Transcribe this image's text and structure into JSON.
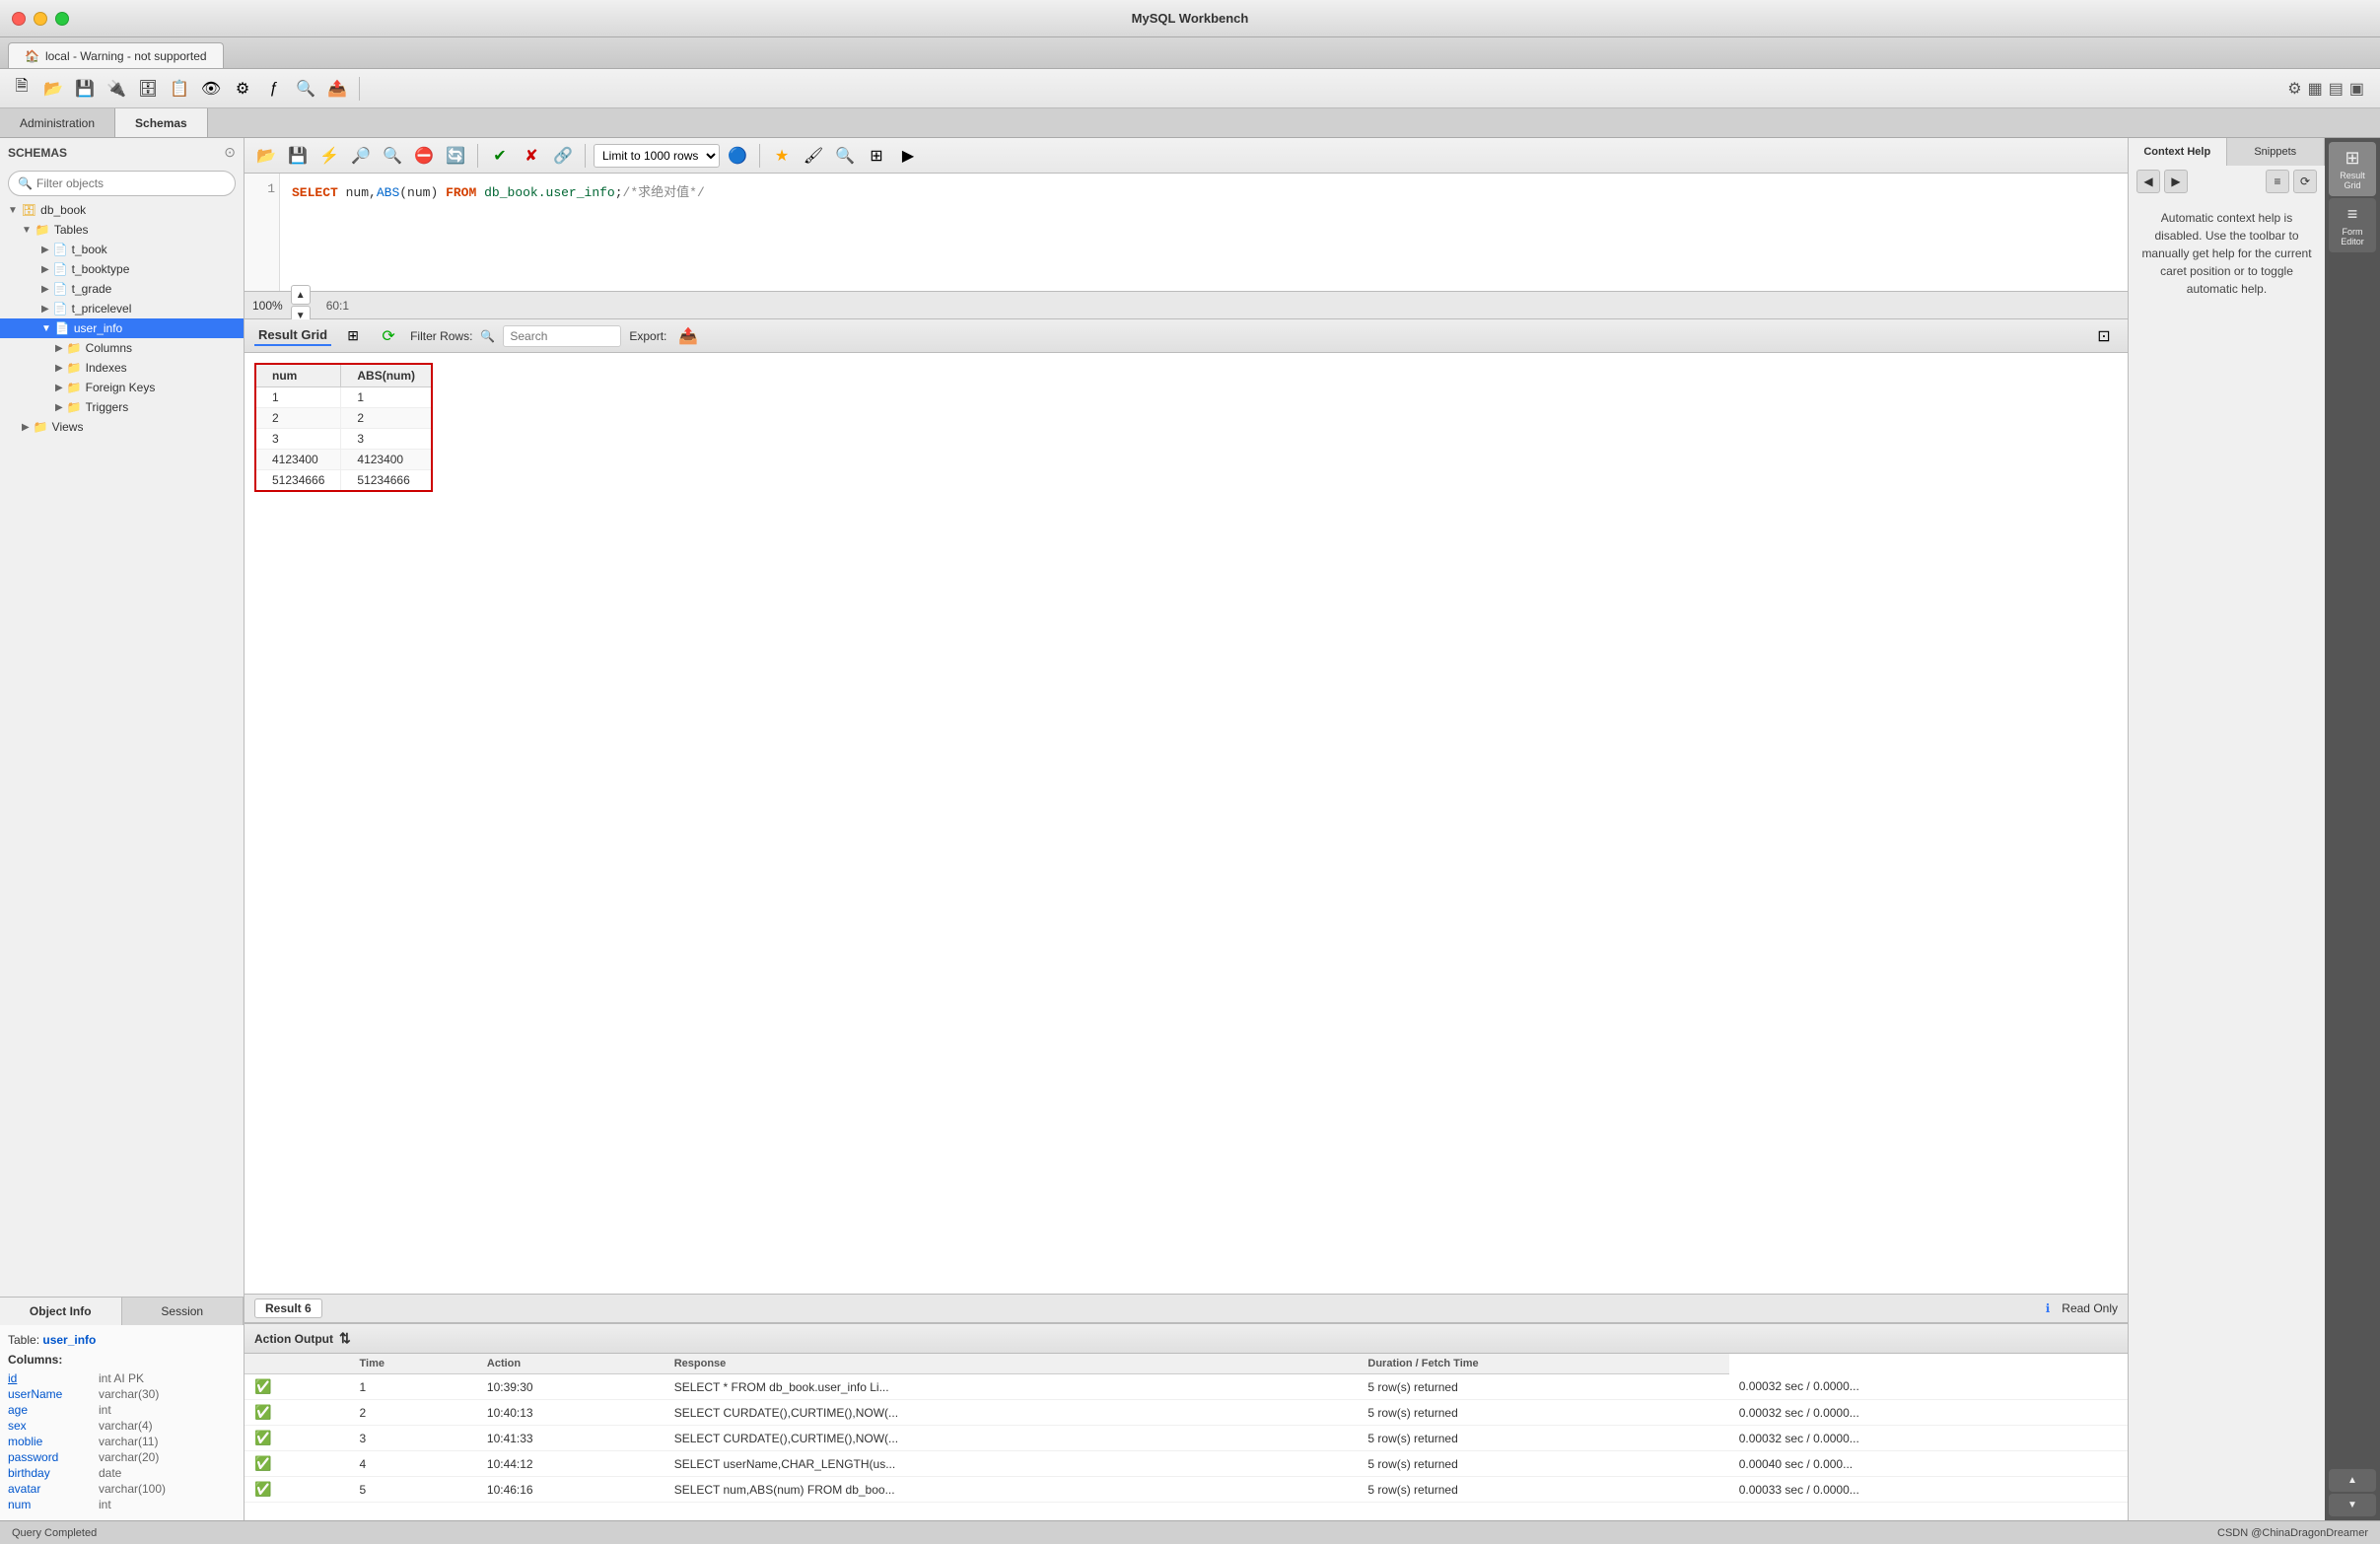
{
  "titlebar": {
    "title": "MySQL Workbench"
  },
  "tab": {
    "label": "local - Warning - not supported",
    "icon": "🏠"
  },
  "panel_tabs": [
    "Administration",
    "Schemas"
  ],
  "schemas_header": "SCHEMAS",
  "filter_placeholder": "Filter objects",
  "tree": [
    {
      "label": "db_book",
      "level": 1,
      "type": "db",
      "expanded": true
    },
    {
      "label": "Tables",
      "level": 2,
      "type": "folder",
      "expanded": true
    },
    {
      "label": "t_book",
      "level": 3,
      "type": "table"
    },
    {
      "label": "t_booktype",
      "level": 3,
      "type": "table"
    },
    {
      "label": "t_grade",
      "level": 3,
      "type": "table"
    },
    {
      "label": "t_pricelevel",
      "level": 3,
      "type": "table"
    },
    {
      "label": "user_info",
      "level": 3,
      "type": "table",
      "selected": true
    },
    {
      "label": "Columns",
      "level": 4,
      "type": "folder"
    },
    {
      "label": "Indexes",
      "level": 4,
      "type": "folder"
    },
    {
      "label": "Foreign Keys",
      "level": 4,
      "type": "folder"
    },
    {
      "label": "Triggers",
      "level": 4,
      "type": "folder"
    },
    {
      "label": "Views",
      "level": 2,
      "type": "folder"
    }
  ],
  "object_info_tabs": [
    "Object Info",
    "Session"
  ],
  "object_info": {
    "table_label": "Table:",
    "table_name": "user_info",
    "columns_label": "Columns:",
    "columns": [
      {
        "name": "id",
        "type": "int AI PK",
        "is_pk": true
      },
      {
        "name": "userName",
        "type": "varchar(30)"
      },
      {
        "name": "age",
        "type": "int"
      },
      {
        "name": "sex",
        "type": "varchar(4)"
      },
      {
        "name": "moblie",
        "type": "varchar(11)"
      },
      {
        "name": "password",
        "type": "varchar(20)"
      },
      {
        "name": "birthday",
        "type": "date"
      },
      {
        "name": "avatar",
        "type": "varchar(100)"
      },
      {
        "name": "num",
        "type": "int"
      }
    ]
  },
  "context_tabs": [
    "Context Help",
    "Snippets"
  ],
  "context_help_text": "Automatic context help is disabled. Use the toolbar to manually get help for the current caret position or to toggle automatic help.",
  "sql_line": "1",
  "sql_code": "SELECT num,ABS(num) FROM db_book.user_info;/*求绝对值*/",
  "zoom": "100%",
  "caret_pos": "60:1",
  "limit_label": "Limit to 1000 rows",
  "result_toolbar": {
    "result_grid_label": "Result Grid",
    "filter_rows_label": "Filter Rows:",
    "search_placeholder": "Search",
    "export_label": "Export:"
  },
  "result_grid": {
    "columns": [
      "num",
      "ABS(num)"
    ],
    "rows": [
      [
        "1",
        "1"
      ],
      [
        "2",
        "2"
      ],
      [
        "3",
        "3"
      ],
      [
        "4123400",
        "4123400"
      ],
      [
        "51234666",
        "51234666"
      ]
    ]
  },
  "result_tab": "Result 6",
  "read_only_label": "Read Only",
  "action_output_header": "Action Output",
  "action_table": {
    "columns": [
      "",
      "Time",
      "Action",
      "Response",
      "Duration / Fetch Time"
    ],
    "rows": [
      {
        "num": "1",
        "time": "10:39:30",
        "action": "SELECT * FROM db_book.user_info Li...",
        "response": "5 row(s) returned",
        "duration": "0.00032 sec / 0.0000..."
      },
      {
        "num": "2",
        "time": "10:40:13",
        "action": "SELECT CURDATE(),CURTIME(),NOW(...",
        "response": "5 row(s) returned",
        "duration": "0.00032 sec / 0.0000..."
      },
      {
        "num": "3",
        "time": "10:41:33",
        "action": "SELECT CURDATE(),CURTIME(),NOW(...",
        "response": "5 row(s) returned",
        "duration": "0.00032 sec / 0.0000..."
      },
      {
        "num": "4",
        "time": "10:44:12",
        "action": "SELECT userName,CHAR_LENGTH(us...",
        "response": "5 row(s) returned",
        "duration": "0.00040 sec / 0.000..."
      },
      {
        "num": "5",
        "time": "10:46:16",
        "action": "SELECT num,ABS(num) FROM db_boo...",
        "response": "5 row(s) returned",
        "duration": "0.00033 sec / 0.0000..."
      }
    ]
  },
  "right_strip": [
    {
      "id": "result-grid-strip",
      "icon": "⊞",
      "label": "Result\nGrid",
      "active": true
    },
    {
      "id": "form-editor-strip",
      "icon": "≡",
      "label": "Form\nEditor",
      "active": false
    }
  ],
  "statusbar": {
    "left": "Query Completed",
    "right": "CSDN @ChinaDragonDreamer"
  }
}
